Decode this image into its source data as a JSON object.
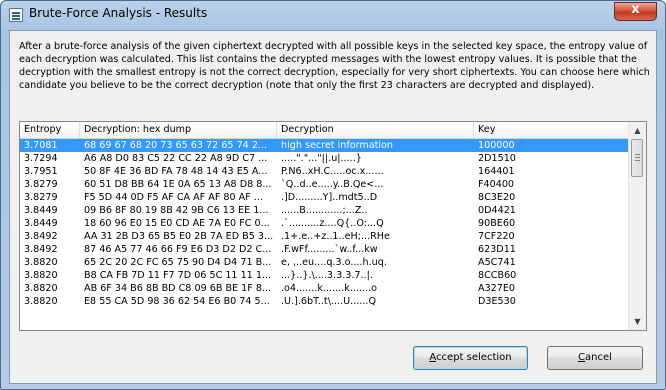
{
  "window": {
    "title": "Brute-Force Analysis - Results",
    "close_symbol": "x"
  },
  "description": "After a brute-force analysis of the given ciphertext decrypted with all possible keys in the selected key space, the entropy value of each decryption was calculated. This list contains the decrypted messages with the lowest entropy values. It is possible that the decryption with the smallest entropy is not the correct decryption, especially for very short ciphertexts. You can choose here which candidate you believe to be the correct decryption (note that only the first 23 characters are decrypted and displayed).",
  "table": {
    "columns": [
      "Entropy",
      "Decryption: hex dump",
      "Decryption",
      "Key"
    ],
    "rows": [
      [
        "3.7081",
        "68 69 67 68 20 73 65 63 72 65 74 2...",
        "high secret information",
        "100000"
      ],
      [
        "3.7294",
        "A6 A8 D0 83 C5 22 CC 22 A8 9D C7 ...",
        ".....\".\"...\"||.u|.....}",
        "2D1510"
      ],
      [
        "3.7951",
        "50 8F 4E 36 BD FA 78 48 14 43 E5 A...",
        "P.N6..xH.C.....oc.x......",
        "164401"
      ],
      [
        "3.8279",
        "60 51 D8 BB 64 1E 0A 65 13 A8 D8 8...",
        "`Q..d..e.....y..B.Qe<...",
        "F40400"
      ],
      [
        "3.8279",
        "F5 5D 44 0D F5 AF CA AF AF 80 AF ...",
        ".]D.........Y]..mdt5..D",
        "8C3E20"
      ],
      [
        "3.8449",
        "09 B6 8F 80 19 8B 42 9B C6 13 EE 1...",
        "......B............;...Z..",
        "0D4421"
      ],
      [
        "3.8449",
        "18 60 96 E0 15 E0 CD AE 7A E0 FC 0...",
        ".`..........z....Q{..O:...Q",
        "90BE60"
      ],
      [
        "3.8492",
        "AA 31 2B D3 65 B5 E0 2B 7A ED B5 3...",
        ".1+.e..+z..1..eH;...RHe",
        "7CF220"
      ],
      [
        "3.8492",
        "87 46 A5 77 46 66 F9 E6 D3 D2 D2 C...",
        ".F.wFf.........`w..f...kw",
        "623D11"
      ],
      [
        "3.8820",
        "65 2C 20 2C FC 65 75 90 D4 D4 71 B...",
        "e, ,..eu....q.3.o....h.uq.",
        "A5C741"
      ],
      [
        "3.8820",
        "B8 CA FB 7D 11 F7 7D 06 5C 11 11 1...",
        "...}..}.\\....3.3.3.7..|.",
        "8CCB60"
      ],
      [
        "3.8820",
        "AB 6F 34 B6 8B BD C8 09 6B BE 1F 8...",
        ".o4.......k.......k.......o",
        "A327E0"
      ],
      [
        "3.8820",
        "E8 55 CA 5D 98 36 62 54 E6 B0 74 5...",
        ".U.].6bT..t\\....U......Q",
        "D3E530"
      ]
    ],
    "selected_index": 0
  },
  "scrollbar": {
    "up_symbol": "▲",
    "down_symbol": "▼"
  },
  "buttons": {
    "accept_mnemonic": "A",
    "accept_rest": "ccept selection",
    "cancel_mnemonic": "C",
    "cancel_rest": "ancel"
  }
}
